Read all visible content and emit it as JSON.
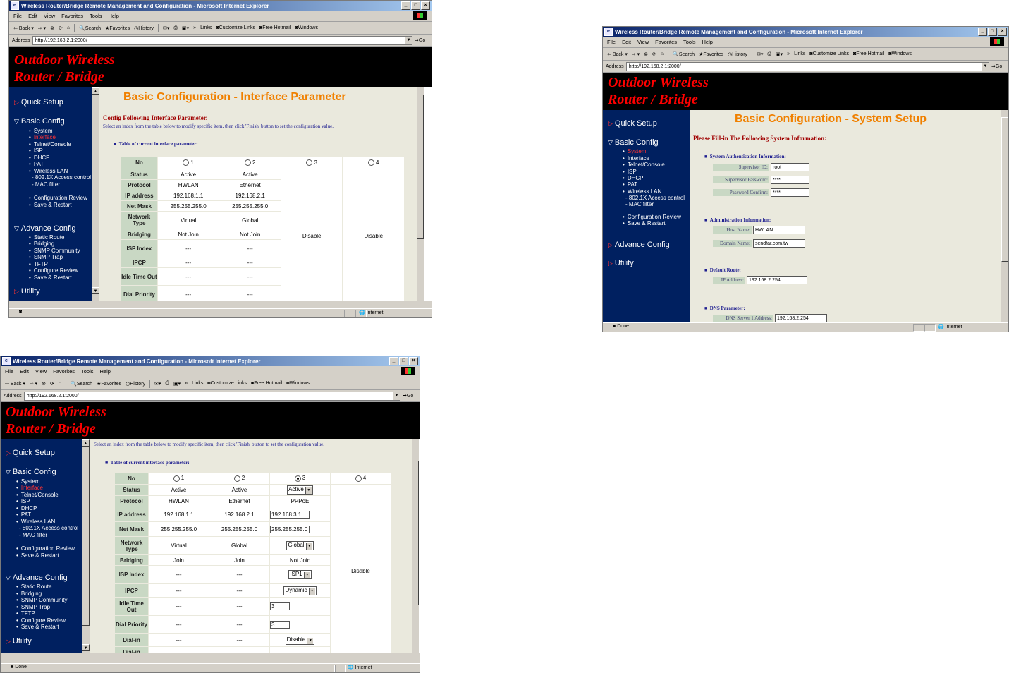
{
  "browser": {
    "title": "Wireless Router/Bridge Remote Management and Configuration - Microsoft Internet Explorer",
    "menu": [
      "File",
      "Edit",
      "View",
      "Favorites",
      "Tools",
      "Help"
    ],
    "toolbar": [
      "Back",
      "Search",
      "Favorites",
      "History",
      "Links",
      "Customize Links",
      "Free Hotmail",
      "Windows"
    ],
    "address_label": "Address",
    "go_label": "Go",
    "done": "Done",
    "zone": "Internet"
  },
  "banner": {
    "line1": "Outdoor Wireless",
    "line2": "Router / Bridge"
  },
  "sidebar": {
    "quick_setup": "Quick Setup",
    "basic_config": "Basic Config",
    "basic_items": [
      "System",
      "Interface",
      "Telnet/Console",
      "ISP",
      "DHCP",
      "PAT",
      "Wireless LAN"
    ],
    "wlan_sub": [
      "- 802.1X Access control",
      "- MAC filter"
    ],
    "basic_items2": [
      "Configuration Review",
      "Save & Restart"
    ],
    "advance_config": "Advance Config",
    "advance_items": [
      "Static Route",
      "Bridging",
      "SNMP Community",
      "SNMP Trap",
      "TFTP",
      "Configure Review",
      "Save & Restart"
    ],
    "utility": "Utility"
  },
  "win1": {
    "url": "http://192.168.2.1:2000/",
    "page_title": "Basic Configuration - Interface Parameter",
    "subtitle": "Config Following Interface Parameter.",
    "desc": "Select an index from the table below to modify specific item, then click 'Finish' button to set the configuration value.",
    "table_head": "Table of current interface parameter:",
    "labels": [
      "No",
      "Status",
      "Protocol",
      "IP address",
      "Net Mask",
      "Network Type",
      "Bridging",
      "ISP Index",
      "IPCP",
      "Idle Time Out",
      "Dial Priority"
    ],
    "cols": [
      "1",
      "2",
      "3",
      "4"
    ],
    "c1": [
      "Active",
      "HWLAN",
      "192.168.1.1",
      "255.255.255.0",
      "Virtual",
      "Not Join",
      "---",
      "---",
      "---",
      "---"
    ],
    "c2": [
      "Active",
      "Ethernet",
      "192.168.2.1",
      "255.255.255.0",
      "Global",
      "Not Join",
      "---",
      "---",
      "---",
      "---"
    ],
    "c3": "Disable",
    "c4": "Disable"
  },
  "win2": {
    "url": "http://192.168.2.1:2000/",
    "page_title": "Basic Configuration - System Setup",
    "subtitle": "Please Fill-in The Following System Information:",
    "auth_head": "System Authentication Information:",
    "supervisor_id_label": "Supervisor ID:",
    "supervisor_id": "root",
    "supervisor_pw_label": "Supervisor Password:",
    "supervisor_pw": "****",
    "pw_confirm_label": "Password Confirm:",
    "pw_confirm": "****",
    "admin_head": "Administration Information:",
    "host_label": "Host Name:",
    "host": "HWLAN",
    "domain_label": "Domain Name:",
    "domain": "sendfar.com.tw",
    "route_head": "Default Route:",
    "ip_label": "IP Address:",
    "ip": "192.168.2.254",
    "dns_head": "DNS Parameter:",
    "dns1_label": "DNS Server 1 Address:",
    "dns1": "192.168.2.254"
  },
  "win3": {
    "url": "http://192.168.2.1:2000/",
    "desc": "Select an index from the table below to modify specific item, then click 'Finish' button to set the configuration value.",
    "table_head": "Table of current interface parameter:",
    "labels": [
      "No",
      "Status",
      "Protocol",
      "IP address",
      "Net Mask",
      "Network Type",
      "Bridging",
      "ISP Index",
      "IPCP",
      "Idle Time Out",
      "Dial Priority",
      "Dial-in",
      "Dial-in"
    ],
    "cols": [
      "1",
      "2",
      "3",
      "4"
    ],
    "c1": [
      "Active",
      "HWLAN",
      "192.168.1.1",
      "255.255.255.0",
      "Virtual",
      "Join",
      "---",
      "---",
      "---",
      "---",
      "---"
    ],
    "c2": [
      "Active",
      "Ethernet",
      "192.168.2.1",
      "255.255.255.0",
      "Global",
      "Join",
      "---",
      "---",
      "---",
      "---",
      "---"
    ],
    "c3": {
      "status": "Active",
      "protocol": "PPPoE",
      "ip": "192.168.3.1",
      "mask": "255.255.255.0",
      "type": "Global",
      "bridging": "Not Join",
      "isp": "ISP1",
      "ipcp": "Dynamic",
      "idle": "3",
      "dial": "3",
      "dialin": "Disable"
    },
    "c4": "Disable"
  }
}
